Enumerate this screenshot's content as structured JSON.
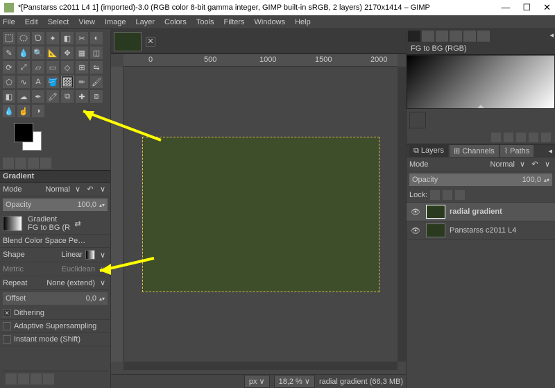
{
  "title": "*[Panstarss c2011 L4 1] (imported)-3.0 (RGB color 8-bit gamma integer, GIMP built-in sRGB, 2 layers) 2170x1414 – GIMP",
  "menu": [
    "File",
    "Edit",
    "Select",
    "View",
    "Image",
    "Layer",
    "Colors",
    "Tools",
    "Filters",
    "Windows",
    "Help"
  ],
  "ruler_ticks": [
    "0",
    "500",
    "1000",
    "1500",
    "2000"
  ],
  "grad": {
    "panel_title": "Gradient",
    "mode_label": "Mode",
    "mode_value": "Normal",
    "opacity_label": "Opacity",
    "opacity_value": "100,0",
    "grad_label": "Gradient",
    "grad_name": "FG to BG (R",
    "blend_label": "Blend Color Space Pe…",
    "shape_label": "Shape",
    "shape_value": "Linear",
    "metric_label": "Metric",
    "metric_value": "Euclidean",
    "repeat_label": "Repeat",
    "repeat_value": "None (extend)",
    "offset_label": "Offset",
    "offset_value": "0,0",
    "dither": "Dithering",
    "adaptive": "Adaptive Supersampling",
    "instant": "Instant mode  (Shift)"
  },
  "right": {
    "grad_title": "FG to BG (RGB)",
    "layers_tab": "Layers",
    "channels_tab": "Channels",
    "paths_tab": "Paths",
    "mode_label": "Mode",
    "mode_value": "Normal",
    "opacity_label": "Opacity",
    "opacity_value": "100,0",
    "lock_label": "Lock:",
    "layer1": "radial gradient",
    "layer2": "Panstarss c2011 L4"
  },
  "status": {
    "unit": "px",
    "zoom": "18,2 %",
    "info": "radial gradient (66,3 MB)"
  }
}
